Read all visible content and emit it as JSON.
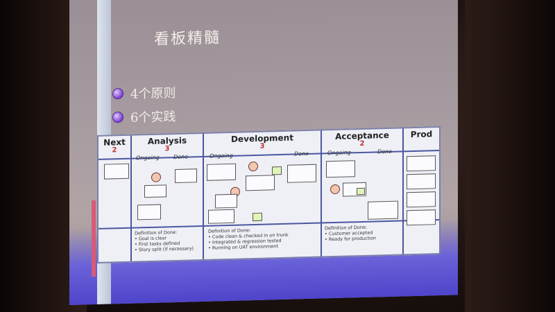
{
  "slide": {
    "title": "看板精髓",
    "bullets": [
      "4个原则",
      "6个实践"
    ]
  },
  "board": {
    "columns": [
      {
        "name": "Next",
        "wip": "2"
      },
      {
        "name": "Analysis",
        "wip": "3",
        "sub": [
          "Ongoing",
          "Done"
        ]
      },
      {
        "name": "Development",
        "wip": "3",
        "sub": [
          "Ongoing",
          "Done"
        ]
      },
      {
        "name": "Acceptance",
        "wip": "2",
        "sub": [
          "Ongoing",
          "Done"
        ]
      },
      {
        "name": "Prod",
        "wip": ""
      }
    ],
    "dod": [
      {
        "title": "Definition of Done:",
        "items": [
          "• Goal is clear",
          "• First tasks defined",
          "• Story split (if necessary)"
        ]
      },
      {
        "title": "Definition of Done:",
        "items": [
          "• Code clean & checked in on trunk",
          "• Integrated & regression tested",
          "• Running on UAT environment"
        ]
      },
      {
        "title": "Definition of Done:",
        "items": [
          "• Customer accepted",
          "• Ready for production"
        ]
      }
    ]
  }
}
